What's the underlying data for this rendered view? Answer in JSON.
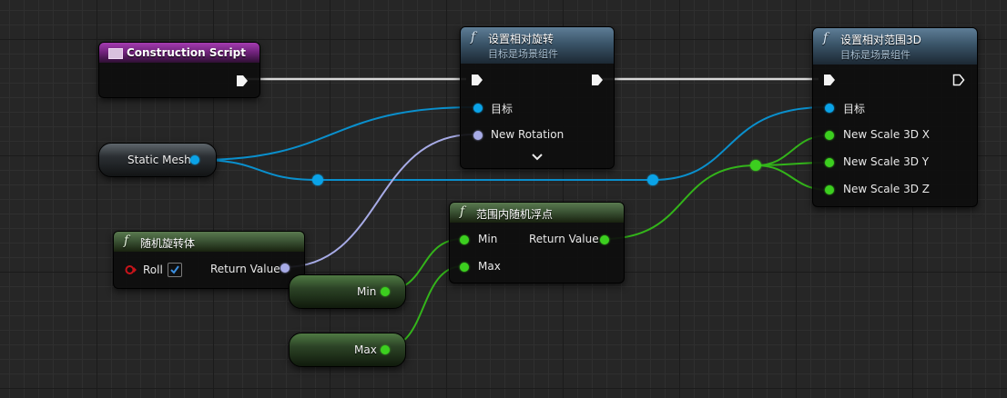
{
  "colors": {
    "exec": "#f0f0f0",
    "object": "#0aa3e8",
    "float": "#3ccf1f",
    "rotator": "#a7abe6",
    "roll_pin": "#c8141a",
    "check": "#3b8fe0"
  },
  "construction_script": {
    "title": "Construction Script",
    "icon": "construction-script-icon"
  },
  "set_relative_rotation": {
    "function_icon": "f",
    "title": "设置相对旋转",
    "subtitle": "目标是场景组件",
    "pins": {
      "target": "目标",
      "new_rotation": "New Rotation"
    },
    "expand_icon": "chevron-down-icon"
  },
  "set_relative_scale": {
    "function_icon": "f",
    "title": "设置相对范围3D",
    "subtitle": "目标是场景组件",
    "pins": {
      "target": "目标",
      "scale_x": "New Scale 3D X",
      "scale_y": "New Scale 3D Y",
      "scale_z": "New Scale 3D Z"
    }
  },
  "static_mesh": {
    "label": "Static Mesh"
  },
  "random_rotator": {
    "function_icon": "f",
    "title": "随机旋转体",
    "roll_label": "Roll",
    "roll_checked": true,
    "return_label": "Return Value"
  },
  "random_float_in_range": {
    "function_icon": "f",
    "title": "范围内随机浮点",
    "min_label": "Min",
    "max_label": "Max",
    "return_label": "Return Value"
  },
  "min_variable": {
    "label": "Min"
  },
  "max_variable": {
    "label": "Max"
  }
}
